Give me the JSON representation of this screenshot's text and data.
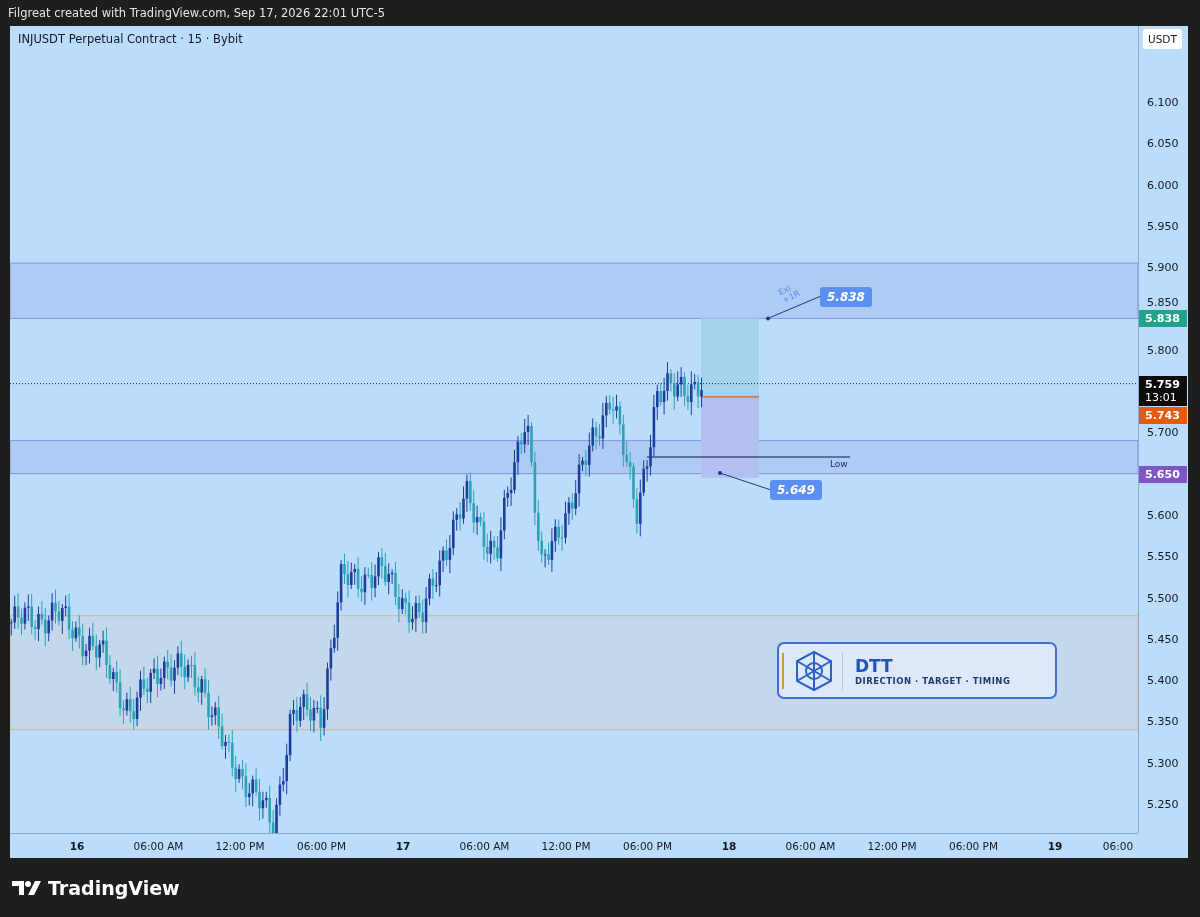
{
  "header": {
    "text": "Filgreat created with TradingView.com, Sep 17, 2026 22:01 UTC-5"
  },
  "chart": {
    "title": "INJUSDT Perpetual Contract · 15 · Bybit",
    "currency": "USDT",
    "price_ticks": [
      "6.100",
      "6.050",
      "6.000",
      "5.950",
      "5.900",
      "5.850",
      "5.800",
      "5.700",
      "5.600",
      "5.550",
      "5.500",
      "5.450",
      "5.400",
      "5.350",
      "5.300",
      "5.250"
    ],
    "price_tags": [
      {
        "text": "5.838",
        "color": "#22a38a"
      },
      {
        "text": "5.759",
        "sub": "13:01",
        "color": "#0c0c0c"
      },
      {
        "text": "5.743",
        "color": "#e8590c"
      },
      {
        "text": "5.650",
        "color": "#7e57c2"
      }
    ],
    "time_ticks": [
      {
        "label": "16",
        "kind": "day"
      },
      {
        "label": "06:00 AM",
        "kind": "time"
      },
      {
        "label": "12:00 PM",
        "kind": "time"
      },
      {
        "label": "06:00 PM",
        "kind": "time"
      },
      {
        "label": "17",
        "kind": "day"
      },
      {
        "label": "06:00 AM",
        "kind": "time"
      },
      {
        "label": "12:00 PM",
        "kind": "time"
      },
      {
        "label": "06:00 PM",
        "kind": "time"
      },
      {
        "label": "18",
        "kind": "day"
      },
      {
        "label": "06:00 AM",
        "kind": "time"
      },
      {
        "label": "12:00 PM",
        "kind": "time"
      },
      {
        "label": "06:00 PM",
        "kind": "time"
      },
      {
        "label": "19",
        "kind": "day"
      },
      {
        "label": "06:00",
        "kind": "time"
      }
    ],
    "annotations": {
      "target_label": "5.838",
      "stop_label": "5.649",
      "note_lines": [
        "Exi",
        "+1R"
      ],
      "low_label": "Low"
    }
  },
  "badge": {
    "title": "DTT",
    "subtitle": "DIRECTION · TARGET · TIMING"
  },
  "footer": {
    "logo_text": "TradingView"
  }
}
